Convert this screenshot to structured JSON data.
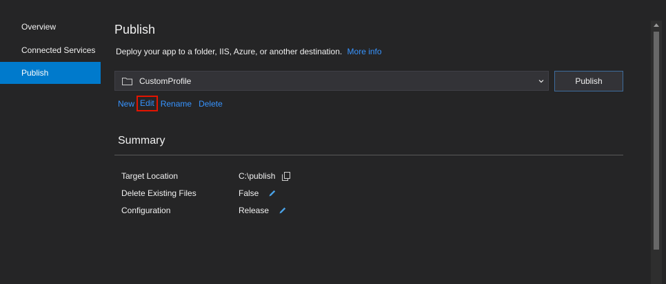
{
  "sidebar": {
    "items": [
      {
        "label": "Overview"
      },
      {
        "label": "Connected Services"
      },
      {
        "label": "Publish"
      }
    ]
  },
  "main": {
    "title": "Publish",
    "subtitle": "Deploy your app to a folder, IIS, Azure, or another destination.",
    "more_info_link": "More info",
    "profile_select": {
      "value": "CustomProfile",
      "folder_icon": "folder-icon",
      "chevron_icon": "chevron-down-icon"
    },
    "publish_button": "Publish",
    "actions": {
      "new": "New",
      "edit": "Edit",
      "rename": "Rename",
      "delete": "Delete"
    },
    "summary": {
      "title": "Summary",
      "rows": [
        {
          "label": "Target Location",
          "value": "C:\\publish",
          "icon": "copy-icon"
        },
        {
          "label": "Delete Existing Files",
          "value": "False",
          "icon": "pencil-icon"
        },
        {
          "label": "Configuration",
          "value": "Release",
          "icon": "pencil-icon"
        }
      ]
    }
  },
  "colors": {
    "background": "#252526",
    "accent": "#007acc",
    "link": "#3794ff",
    "highlight_box": "#e51400"
  }
}
